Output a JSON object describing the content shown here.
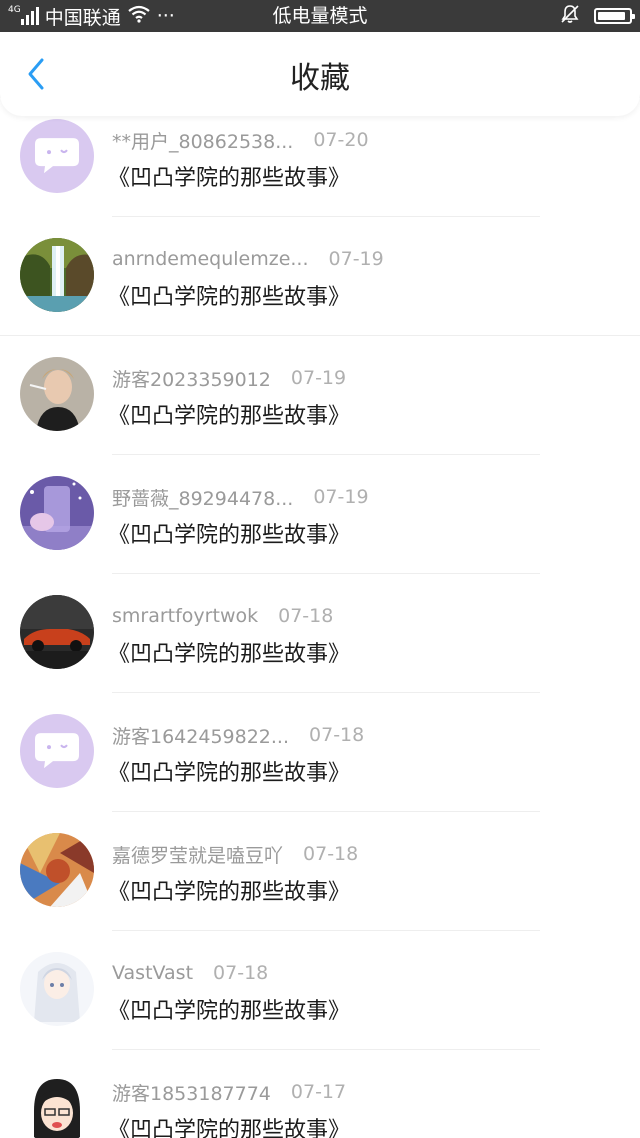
{
  "status_bar": {
    "network": "4G",
    "carrier": "中国联通",
    "more": "···",
    "mode": "低电量模式",
    "battery_level": 0.9
  },
  "header": {
    "title": "收藏",
    "back_icon": "chevron-left-icon"
  },
  "accent_color": "#2a9df4",
  "items": [
    {
      "username": "**用户_80862538...",
      "date": "07-20",
      "title": "《凹凸学院的那些故事》",
      "avatar": "default-bubble"
    },
    {
      "username": "anrndemequlemze...",
      "date": "07-19",
      "title": "《凹凸学院的那些故事》",
      "avatar": "waterfall"
    },
    {
      "username": "游客2023359012",
      "date": "07-19",
      "title": "《凹凸学院的那些故事》",
      "avatar": "person"
    },
    {
      "username": "野蔷薇_89294478...",
      "date": "07-19",
      "title": "《凹凸学院的那些故事》",
      "avatar": "purple-glass"
    },
    {
      "username": "smrartfoyrtwok",
      "date": "07-18",
      "title": "《凹凸学院的那些故事》",
      "avatar": "red-car"
    },
    {
      "username": "游客1642459822...",
      "date": "07-18",
      "title": "《凹凸学院的那些故事》",
      "avatar": "default-bubble"
    },
    {
      "username": "嘉德罗莹就是嗑豆吖",
      "date": "07-18",
      "title": "《凹凸学院的那些故事》",
      "avatar": "colorful-art"
    },
    {
      "username": "VastVast",
      "date": "07-18",
      "title": "《凹凸学院的那些故事》",
      "avatar": "anime-white"
    },
    {
      "username": "游客1853187774",
      "date": "07-17",
      "title": "《凹凸学院的那些故事》",
      "avatar": "anime-girl"
    }
  ]
}
